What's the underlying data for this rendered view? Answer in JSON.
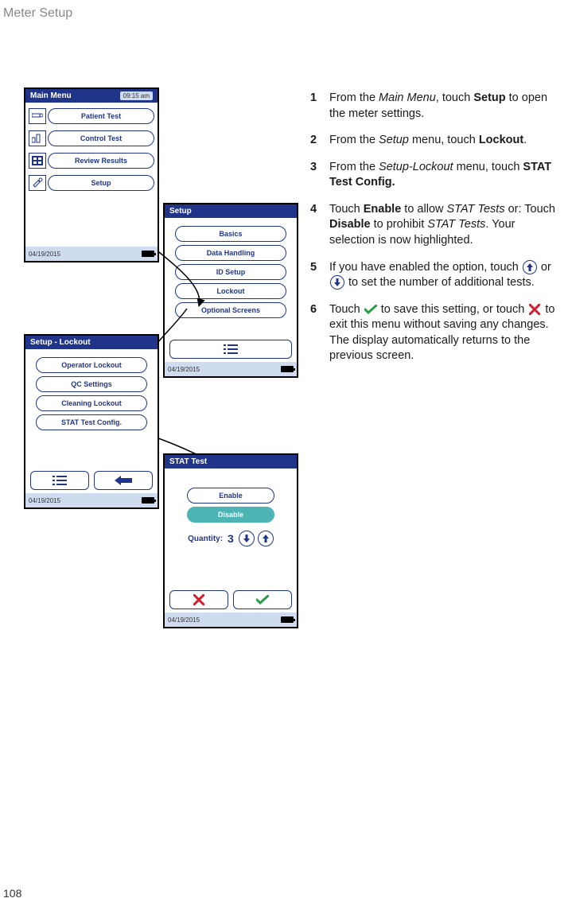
{
  "header": {
    "section": "Meter Setup",
    "page_number": "108"
  },
  "screens": {
    "main": {
      "title": "Main Menu",
      "time": "09:15 am",
      "items": [
        {
          "label": "Patient Test"
        },
        {
          "label": "Control Test"
        },
        {
          "label": "Review Results"
        },
        {
          "label": "Setup"
        }
      ],
      "date": "04/19/2015"
    },
    "setup": {
      "title": "Setup",
      "items": [
        {
          "label": "Basics"
        },
        {
          "label": "Data Handling"
        },
        {
          "label": "ID Setup"
        },
        {
          "label": "Lockout"
        },
        {
          "label": "Optional Screens"
        }
      ],
      "date": "04/19/2015"
    },
    "lockout": {
      "title": "Setup - Lockout",
      "items": [
        {
          "label": "Operator Lockout"
        },
        {
          "label": "QC Settings"
        },
        {
          "label": "Cleaning Lockout"
        },
        {
          "label": "STAT Test Config."
        }
      ],
      "date": "04/19/2015"
    },
    "stat": {
      "title": "STAT Test",
      "enable": "Enable",
      "disable": "Disable",
      "quantity_label": "Quantity:",
      "quantity_value": "3",
      "date": "04/19/2015"
    }
  },
  "steps": [
    {
      "num": "1",
      "parts": [
        {
          "t": "From the "
        },
        {
          "t": "Main Menu",
          "i": true
        },
        {
          "t": ", touch "
        },
        {
          "t": "Setup",
          "b": true
        },
        {
          "t": " to open the meter settings."
        }
      ]
    },
    {
      "num": "2",
      "parts": [
        {
          "t": "From the "
        },
        {
          "t": "Setup",
          "i": true
        },
        {
          "t": " menu, touch "
        },
        {
          "t": "Lockout",
          "b": true
        },
        {
          "t": "."
        }
      ]
    },
    {
      "num": "3",
      "parts": [
        {
          "t": "From the "
        },
        {
          "t": "Setup-Lockout",
          "i": true
        },
        {
          "t": " menu, touch "
        },
        {
          "t": "STAT Test Config.",
          "b": true
        }
      ]
    },
    {
      "num": "4",
      "parts": [
        {
          "t": "Touch "
        },
        {
          "t": "Enable",
          "b": true
        },
        {
          "t": " to allow "
        },
        {
          "t": "STAT Tests",
          "i": true
        },
        {
          "t": " or: Touch "
        },
        {
          "t": "Disable",
          "b": true
        },
        {
          "t": " to prohibit "
        },
        {
          "t": "STAT Tests",
          "i": true
        },
        {
          "t": ". Your selection is now highlighted."
        }
      ]
    },
    {
      "num": "5",
      "parts": [
        {
          "t": "If you have enabled the option, touch "
        },
        {
          "icon": "up"
        },
        {
          "t": " or "
        },
        {
          "icon": "down"
        },
        {
          "t": " to set the number of additional tests."
        }
      ]
    },
    {
      "num": "6",
      "parts": [
        {
          "t": "Touch "
        },
        {
          "icon": "check"
        },
        {
          "t": " to save this setting, or touch "
        },
        {
          "icon": "cross"
        },
        {
          "t": " to exit this menu without saving any changes. The display automatically returns to the previous screen."
        }
      ]
    }
  ]
}
